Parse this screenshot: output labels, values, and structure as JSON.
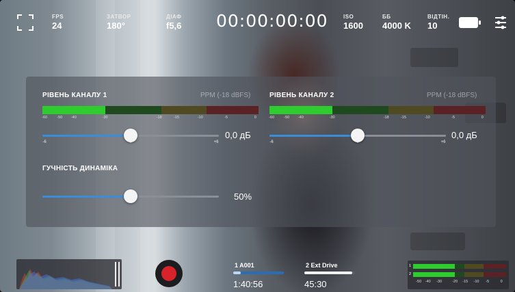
{
  "top_bar": {
    "fps": {
      "label": "FPS",
      "value": "24"
    },
    "shutter": {
      "label": "ЗАТВОР",
      "value": "180°"
    },
    "aperture": {
      "label": "ДІАФ",
      "value": "f5,6"
    },
    "timecode": "00:00:00:00",
    "iso": {
      "label": "ISO",
      "value": "1600"
    },
    "wb": {
      "label": "ББ",
      "value": "4000 K"
    },
    "tint": {
      "label": "ВІДТІН.",
      "value": "10"
    },
    "icons": [
      "focus-frame-icon",
      "battery-icon",
      "settings-sliders-icon"
    ]
  },
  "audio": {
    "channel1": {
      "title": "РІВЕНЬ КАНАЛУ 1",
      "meter_type": "PPM (-18 dBFS)",
      "level_fraction": 0.29,
      "gain_value": "0,0 дБ",
      "gain_fraction": 0.5
    },
    "channel2": {
      "title": "РІВЕНЬ КАНАЛУ 2",
      "meter_type": "PPM (-18 dBFS)",
      "level_fraction": 0.29,
      "gain_value": "0,0 дБ",
      "gain_fraction": 0.5
    },
    "meter_scale": [
      "-60",
      "-50",
      "-40",
      "-30",
      "-18",
      "-15",
      "-10",
      "-5",
      "0"
    ],
    "gain_scale": [
      "-6",
      "0",
      "+6"
    ],
    "speaker": {
      "title": "ГУЧНІСТЬ ДИНАМІКА",
      "value": "50%",
      "fraction": 0.5
    }
  },
  "bottom": {
    "media1": {
      "name": "1  A001",
      "time": "1:40:56",
      "fill_fraction": 0.15
    },
    "media2": {
      "name": "2  Ext Drive",
      "time": "45:30",
      "fill_fraction": 0.95
    },
    "mini_meter_scale": [
      "-50",
      "-40",
      "-30",
      "-20",
      "-15",
      "-10",
      "-5",
      "0"
    ],
    "mini_meter_channels": [
      "1",
      "2"
    ]
  },
  "colors": {
    "accent_blue": "#3b8cd9",
    "record_red": "#d9232a",
    "meter_green": "#2ecc2e"
  }
}
